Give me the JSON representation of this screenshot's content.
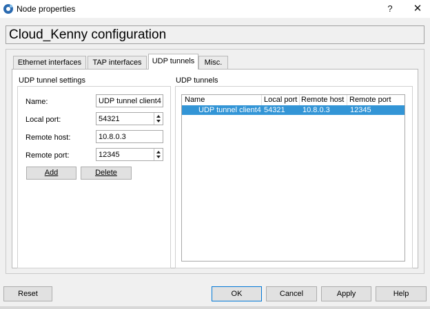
{
  "window": {
    "title": "Node properties",
    "help_label": "?",
    "close_label": "✕"
  },
  "header": {
    "config_title": "Cloud_Kenny configuration"
  },
  "tabs": [
    {
      "label": "Ethernet interfaces",
      "active": false
    },
    {
      "label": "TAP interfaces",
      "active": false
    },
    {
      "label": "UDP tunnels",
      "active": true
    },
    {
      "label": "Misc.",
      "active": false
    }
  ],
  "settings": {
    "group_title": "UDP tunnel settings",
    "name_label": "Name:",
    "name_value": "UDP tunnel client4",
    "local_port_label": "Local port:",
    "local_port_value": "54321",
    "remote_host_label": "Remote host:",
    "remote_host_value": "10.8.0.3",
    "remote_port_label": "Remote port:",
    "remote_port_value": "12345",
    "add_label": "Add",
    "delete_label": "Delete"
  },
  "tunnels": {
    "group_title": "UDP tunnels",
    "columns": [
      "Name",
      "Local port",
      "Remote host",
      "Remote port"
    ],
    "rows": [
      {
        "name": "UDP tunnel client4",
        "local_port": "54321",
        "remote_host": "10.8.0.3",
        "remote_port": "12345",
        "selected": true
      }
    ]
  },
  "footer": {
    "reset_label": "Reset",
    "ok_label": "OK",
    "cancel_label": "Cancel",
    "apply_label": "Apply",
    "help_label": "Help"
  },
  "colors": {
    "selection": "#3395d6",
    "accent": "#0078d7",
    "window_bg": "#f0f0f0"
  },
  "icons": [
    "gns3-app-icon",
    "close-icon",
    "help-icon",
    "spin-up-icon",
    "spin-down-icon"
  ]
}
